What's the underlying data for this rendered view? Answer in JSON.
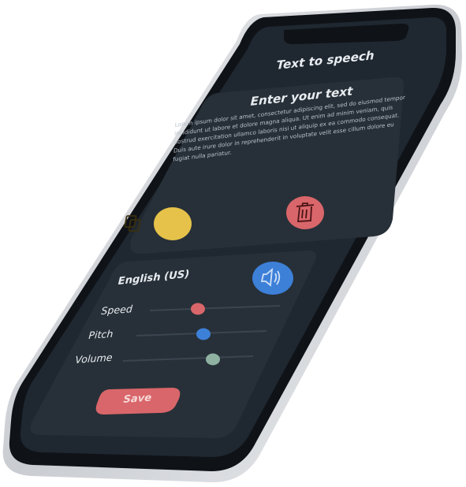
{
  "app": {
    "title": "Text to speech"
  },
  "input_card": {
    "heading": "Enter your text",
    "body": "Lorem ipsum dolor sit amet, consectetur adipiscing elit, sed do eiusmod tempor incididunt ut labore et dolore magna aliqua. Ut enim ad minim veniam, quis nostrud exercitation ullamco laboris nisi ut aliquip ex ea commodo consequat. Duis aute irure dolor in reprehenderit in voluptate velit esse cillum dolore eu fugiat nulla pariatur."
  },
  "settings": {
    "language": "English (US)",
    "speed_label": "Speed",
    "pitch_label": "Pitch",
    "volume_label": "Volume",
    "speed_value": 0.38,
    "pitch_value": 0.52,
    "volume_value": 0.62,
    "save_label": "Save"
  },
  "colors": {
    "screen_bg": "#1f2730",
    "card_bg": "#273038",
    "copy_button": "#e6c24a",
    "delete_button": "#d9666a",
    "speak_button": "#3d80d8",
    "speed_knob": "#d9666a",
    "pitch_knob": "#3d80d8",
    "volume_knob": "#8fb1a2",
    "save_button": "#d9666a"
  },
  "icons": {
    "copy": "copy-icon",
    "delete": "trash-icon",
    "speak": "speaker-icon"
  }
}
